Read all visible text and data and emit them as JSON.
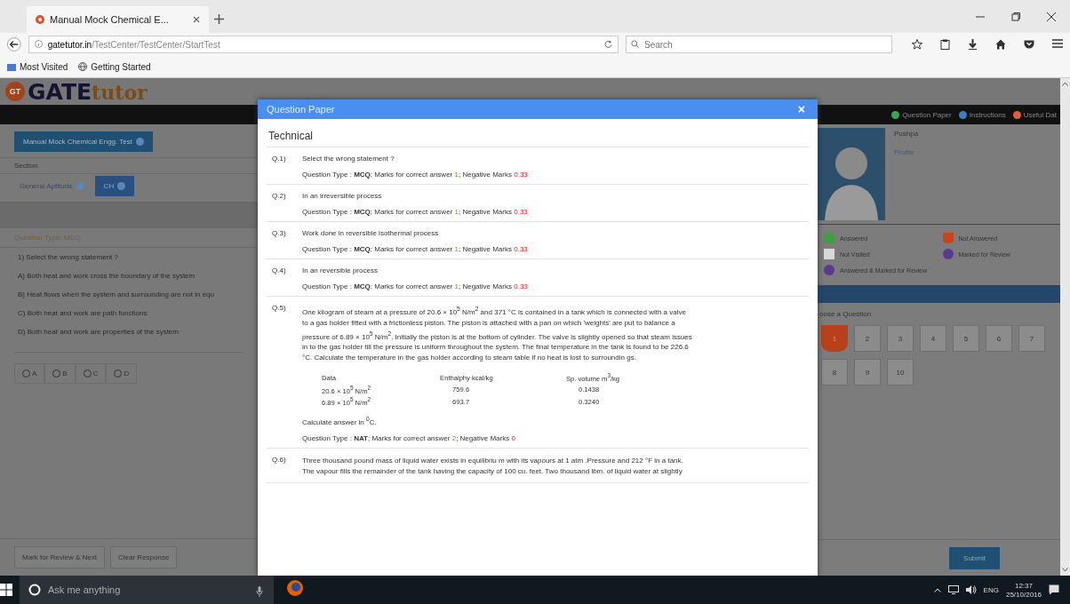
{
  "browser": {
    "tab_title": "Manual Mock Chemical E...",
    "url_domain": "gatetutor.in",
    "url_path": "/TestCenter/TestCenter/StartTest",
    "search_placeholder": "Search",
    "bookmarks": [
      "Most Visited",
      "Getting Started"
    ]
  },
  "site": {
    "logo_badge": "GT",
    "logo_main": "GATE",
    "logo_sub": "tutor",
    "top_links": [
      {
        "label": "Question Paper",
        "color": "#3aa655"
      },
      {
        "label": "Instructions",
        "color": "#3a7fc4"
      },
      {
        "label": "Useful Dat",
        "color": "#d9603b"
      }
    ],
    "test_name": "Manual Mock Chemical Engg. Test",
    "section_label": "Section",
    "sections": [
      {
        "label": "General Aptitude",
        "selected": false
      },
      {
        "label": "CH",
        "selected": true
      }
    ],
    "question_type": "Question Type: MCQ",
    "question": "1) Select the wrong statement ?",
    "options": [
      "A) Both heat and work cross the boundary of the system",
      "B) Heat flows when the system and surrounding are not in equ",
      "C) Both heat and work are path functions",
      "D) Both heat and work are properties of the system"
    ],
    "answers": [
      {
        "label": "A",
        "checked": false
      },
      {
        "label": "B",
        "checked": false
      },
      {
        "label": "C",
        "checked": false
      },
      {
        "label": "D",
        "checked": false
      }
    ],
    "actions": [
      "Mark for Review & Next",
      "Clear Response"
    ],
    "candidate": {
      "name": "Pushpa",
      "link": "Profile"
    },
    "legend": [
      {
        "label": "Answered",
        "color": "#3f9e3f",
        "kind": "answered"
      },
      {
        "label": "Not Answered",
        "color": "#c9431b",
        "kind": "not_answered"
      },
      {
        "label": "Not Visited",
        "color": "#d8d8d8",
        "kind": "not_visited"
      },
      {
        "label": "Marked for Review",
        "color": "#5b3a8c",
        "kind": "marked"
      },
      {
        "label": "Answered & Marked for Review",
        "color": "#5b3a8c",
        "kind": "answered_marked"
      }
    ],
    "palette_title": "oose a Question",
    "palette": [
      {
        "label": "1",
        "kind": "not_answered"
      },
      {
        "label": "2",
        "kind": "not_visited"
      },
      {
        "label": "3",
        "kind": "not_visited"
      },
      {
        "label": "4",
        "kind": "not_visited"
      },
      {
        "label": "5",
        "kind": "not_visited"
      },
      {
        "label": "6",
        "kind": "not_visited"
      },
      {
        "label": "7",
        "kind": "not_visited"
      },
      {
        "label": "8",
        "kind": "not_visited"
      },
      {
        "label": "9",
        "kind": "not_visited"
      },
      {
        "label": "10",
        "kind": "not_visited"
      }
    ],
    "submit": "Submit"
  },
  "dialog": {
    "title": "Question Paper",
    "close": "×",
    "section": "Technical",
    "questions": [
      {
        "number": "Q.1)",
        "text": [
          "Select the wrong statement ?"
        ],
        "type_label": "Question Type :",
        "qtype": "MCQ",
        "marks_label": "; Marks for correct answer",
        "marks": "1",
        "negative_label": "; Negative Marks",
        "negative": "0.33"
      },
      {
        "number": "Q.2)",
        "text": [
          "In an irreversible process"
        ],
        "type_label": "Question Type :",
        "qtype": "MCQ",
        "marks_label": "; Marks for correct answer",
        "marks": "1",
        "negative_label": "; Negative Marks",
        "negative": "0.33"
      },
      {
        "number": "Q.3)",
        "text": [
          "Work done in reversible isothermal process"
        ],
        "type_label": "Question Type :",
        "qtype": "MCQ",
        "marks_label": "; Marks for correct answer",
        "marks": "1",
        "negative_label": "; Negative Marks",
        "negative": "0.33"
      },
      {
        "number": "Q.4)",
        "text": [
          "In an reversible process"
        ],
        "type_label": "Question Type :",
        "qtype": "MCQ",
        "marks_label": "; Marks for correct answer",
        "marks": "1",
        "negative_label": "; Negative Marks",
        "negative": "0.33"
      },
      {
        "number": "Q.5)",
        "text": [
          "One kilogram of steam at a pressure of 20.6 × 10$^{5}$ N/m$^{2}$ and 371 °C is contained in a tank which is connected with a valve to a gas holder fitted with a frictionless piston. The piston is attached with a pan on which 'weights' are put to balance a pressure of 6.89 × 10$^{5}$ N/m$^{2}$. Initially the piston is at the bottom of cylinder. The valve is slightly opened so that steam issues in to the gas holder till the pressure is uniform throughout the system. The final temperature in the tank is found to be 226.6 °C. Calculate the temperature in the gas holder according to steam table if no heat is lost to surroundin gs."
        ],
        "table": {
          "columns": [
            "Data",
            "Enthalphy kcal/kg",
            "Sp. volume m$^{3}$/kg"
          ],
          "rows": [
            [
              "20.6 × 10$^{5}$ N/m$^{2}$",
              "759.6",
              "0.1438"
            ],
            [
              "6.89 × 10$^{5}$ N/m$^{2}$",
              "693.7",
              "0.3240"
            ]
          ]
        },
        "note": "Calculate answer in $^{0}$C.",
        "type_label": "Question Type :",
        "qtype": "NAT",
        "marks_label": "; Marks for correct answer",
        "marks": "2",
        "negative_label": "; Negative Marks",
        "negative": "0"
      },
      {
        "number": "Q.6)",
        "text": [
          "Three thousand pound mass of liquid water exists in equilibriu m with its vapours at 1 atm .Pressure and 212 °F in a tank. The vapour fills the remainder of the tank having the capacity of 100 cu. feet. Two thousand lbm. of liquid water at slightly"
        ]
      }
    ]
  },
  "taskbar": {
    "search_placeholder": "Ask me anything",
    "language": "ENG",
    "time": "12:37",
    "date": "25/10/2016"
  }
}
